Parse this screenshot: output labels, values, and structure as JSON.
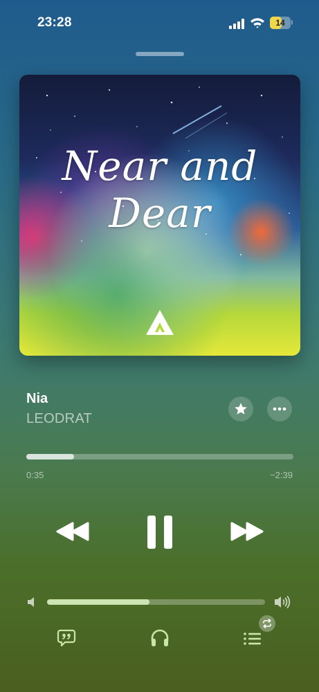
{
  "status_bar": {
    "time": "23:28",
    "battery_level": "14",
    "battery_color": "#f1d64a"
  },
  "artwork": {
    "title_text": "Near and Dear",
    "logo_icon": "triangle-mountain-logo"
  },
  "track": {
    "title": "Nia",
    "artist": "LEODRAT"
  },
  "actions": {
    "favorite_icon": "star-icon",
    "more_icon": "ellipsis-icon"
  },
  "playback": {
    "elapsed": "0:35",
    "remaining": "−2:39",
    "progress_fraction": 0.18,
    "state_icon": "pause-icon"
  },
  "volume": {
    "level_fraction": 0.47
  },
  "bottom_bar": {
    "lyrics_icon": "quote-bubble-icon",
    "output_icon": "headphones-icon",
    "queue_icon": "list-icon",
    "queue_badge_icon": "repeat-icon"
  },
  "colors": {
    "accent_green": "#c8e6a8",
    "background_top": "#1f5b8d",
    "background_bottom": "#4a5e1f"
  }
}
